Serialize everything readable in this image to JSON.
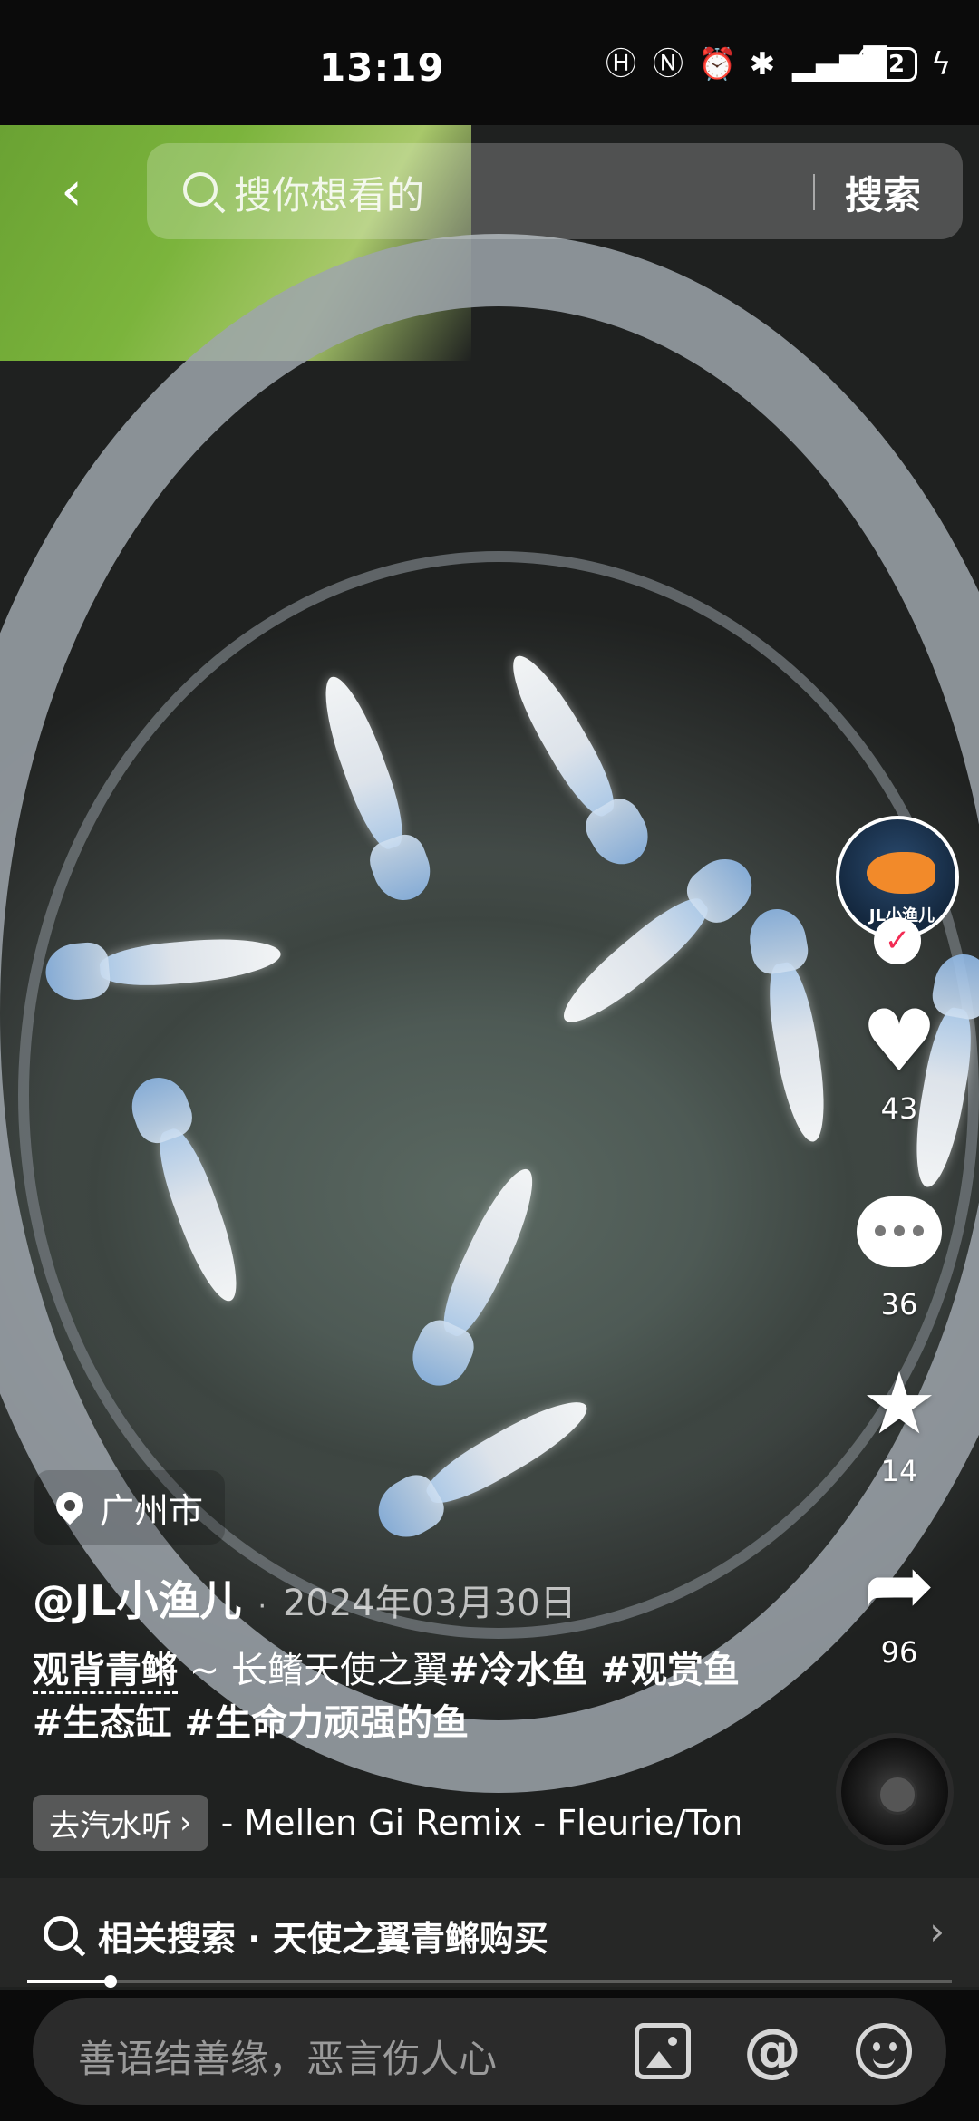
{
  "status_bar": {
    "time": "13:19",
    "icons": [
      "hd-icon",
      "nfc-icon",
      "alarm-icon",
      "bluetooth-icon",
      "4g-icon",
      "signal-icon"
    ],
    "battery": "92"
  },
  "top_bar": {
    "search_placeholder": "搜你想看的",
    "search_button": "搜索"
  },
  "actions": {
    "avatar_text": "JL小渔儿",
    "likes": "43",
    "comments": "36",
    "favorites": "14",
    "shares": "96"
  },
  "location": "广州市",
  "post": {
    "author": "@JL小渔儿",
    "separator": "·",
    "date": "2024年03月30日",
    "desc_link": "观背青鳉",
    "desc_text": " ~ 长鳍天使之翼",
    "desc_tags": "#冷水鱼 #观赏鱼 #生态缸 #生命力顽强的鱼"
  },
  "music": {
    "chip": "去汽水听",
    "title": "- Mellen Gi Remix - Fleurie/Tom"
  },
  "related_search": {
    "label": "相关搜索 · 天使之翼青鳉购买"
  },
  "progress": {
    "fraction": 0.09
  },
  "comment_bar": {
    "placeholder": "善语结善缘，恶言伤人心"
  },
  "colors": {
    "accent": "#f22c54",
    "bar_bg": "#2b2b2b"
  }
}
